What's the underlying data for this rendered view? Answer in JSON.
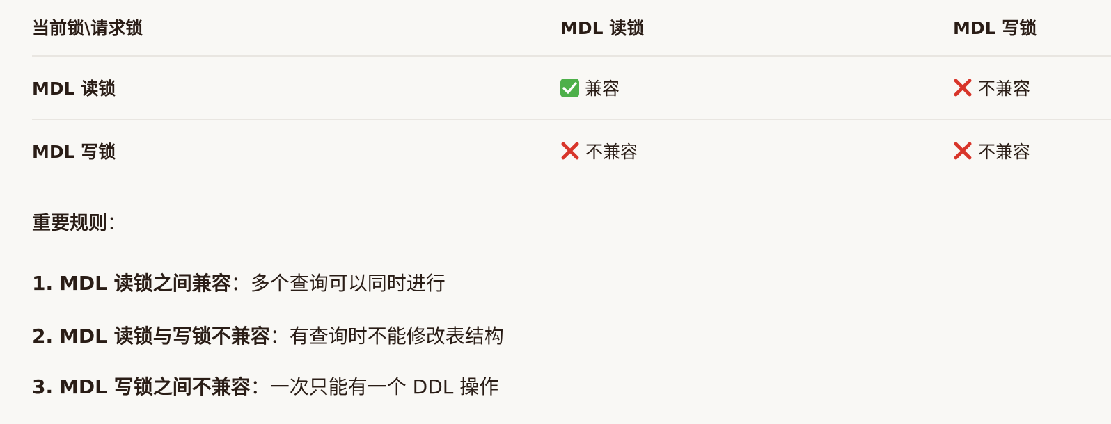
{
  "table": {
    "headers": [
      "当前锁\\请求锁",
      "MDL 读锁",
      "MDL 写锁"
    ],
    "rows": [
      {
        "label": "MDL 读锁",
        "cells": [
          {
            "status": "compatible",
            "icon": "check-mark-icon",
            "text": "兼容"
          },
          {
            "status": "incompatible",
            "icon": "cross-mark-icon",
            "text": "不兼容"
          }
        ]
      },
      {
        "label": "MDL 写锁",
        "cells": [
          {
            "status": "incompatible",
            "icon": "cross-mark-icon",
            "text": "不兼容"
          },
          {
            "status": "incompatible",
            "icon": "cross-mark-icon",
            "text": "不兼容"
          }
        ]
      }
    ]
  },
  "rules": {
    "title": "重要规则",
    "title_suffix": "：",
    "items": [
      {
        "number": "1.",
        "bold": "MDL 读锁之间兼容",
        "sep": "：",
        "desc": "多个查询可以同时进行"
      },
      {
        "number": "2.",
        "bold": "MDL 读锁与写锁不兼容",
        "sep": "：",
        "desc": "有查询时不能修改表结构"
      },
      {
        "number": "3.",
        "bold": "MDL 写锁之间不兼容",
        "sep": "：",
        "desc": "一次只能有一个 DDL 操作"
      }
    ]
  },
  "colors": {
    "background": "#f9f8f5",
    "text": "#2a1d16",
    "check_green": "#4db04a",
    "cross_red": "#d8352a",
    "divider": "#e9e6e1"
  }
}
